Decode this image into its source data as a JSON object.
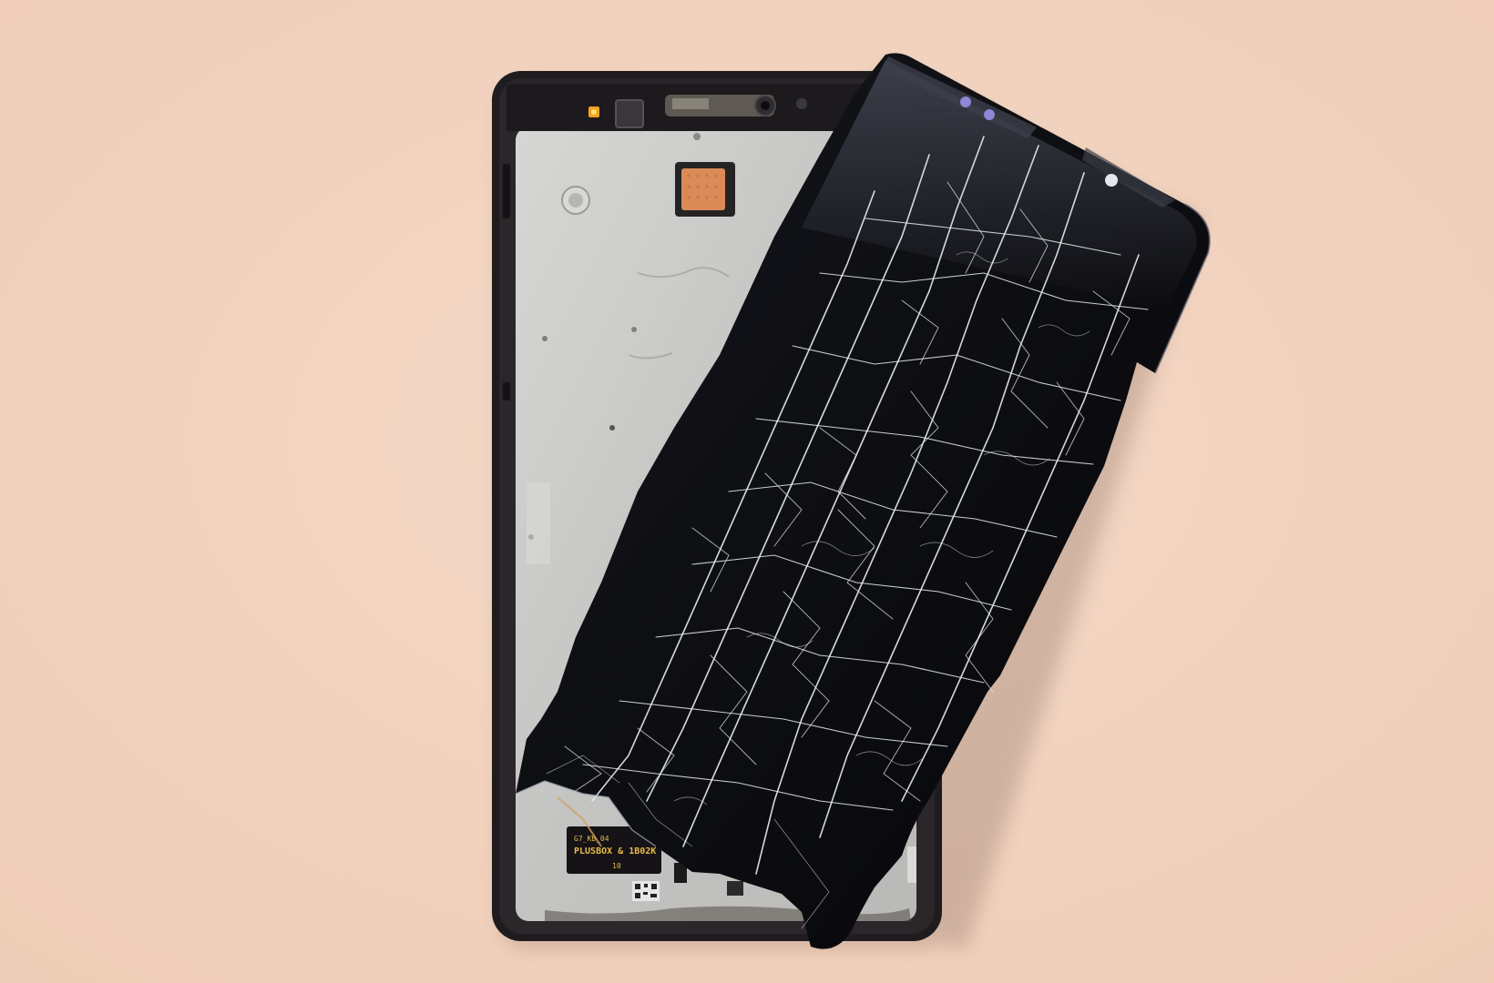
{
  "scene": {
    "description_subject": "broken-phone",
    "colors": {
      "background": "#f2d3bf",
      "background_shadow": "#e8c4ae",
      "frame_dark": "#1f1c1f",
      "frame_inner_metal": "#c9c9c9",
      "glass_black": "#0b0b0e",
      "crack_white": "#e9eef2",
      "camera_cutout": "#8f86d8",
      "orange_sticker": "#d98a56",
      "flex_gold": "#c89a3c"
    }
  },
  "pcb_label": {
    "line1": "G7_KB_04",
    "line2": "PLUSBOX & 1B02K",
    "line3": "10"
  }
}
